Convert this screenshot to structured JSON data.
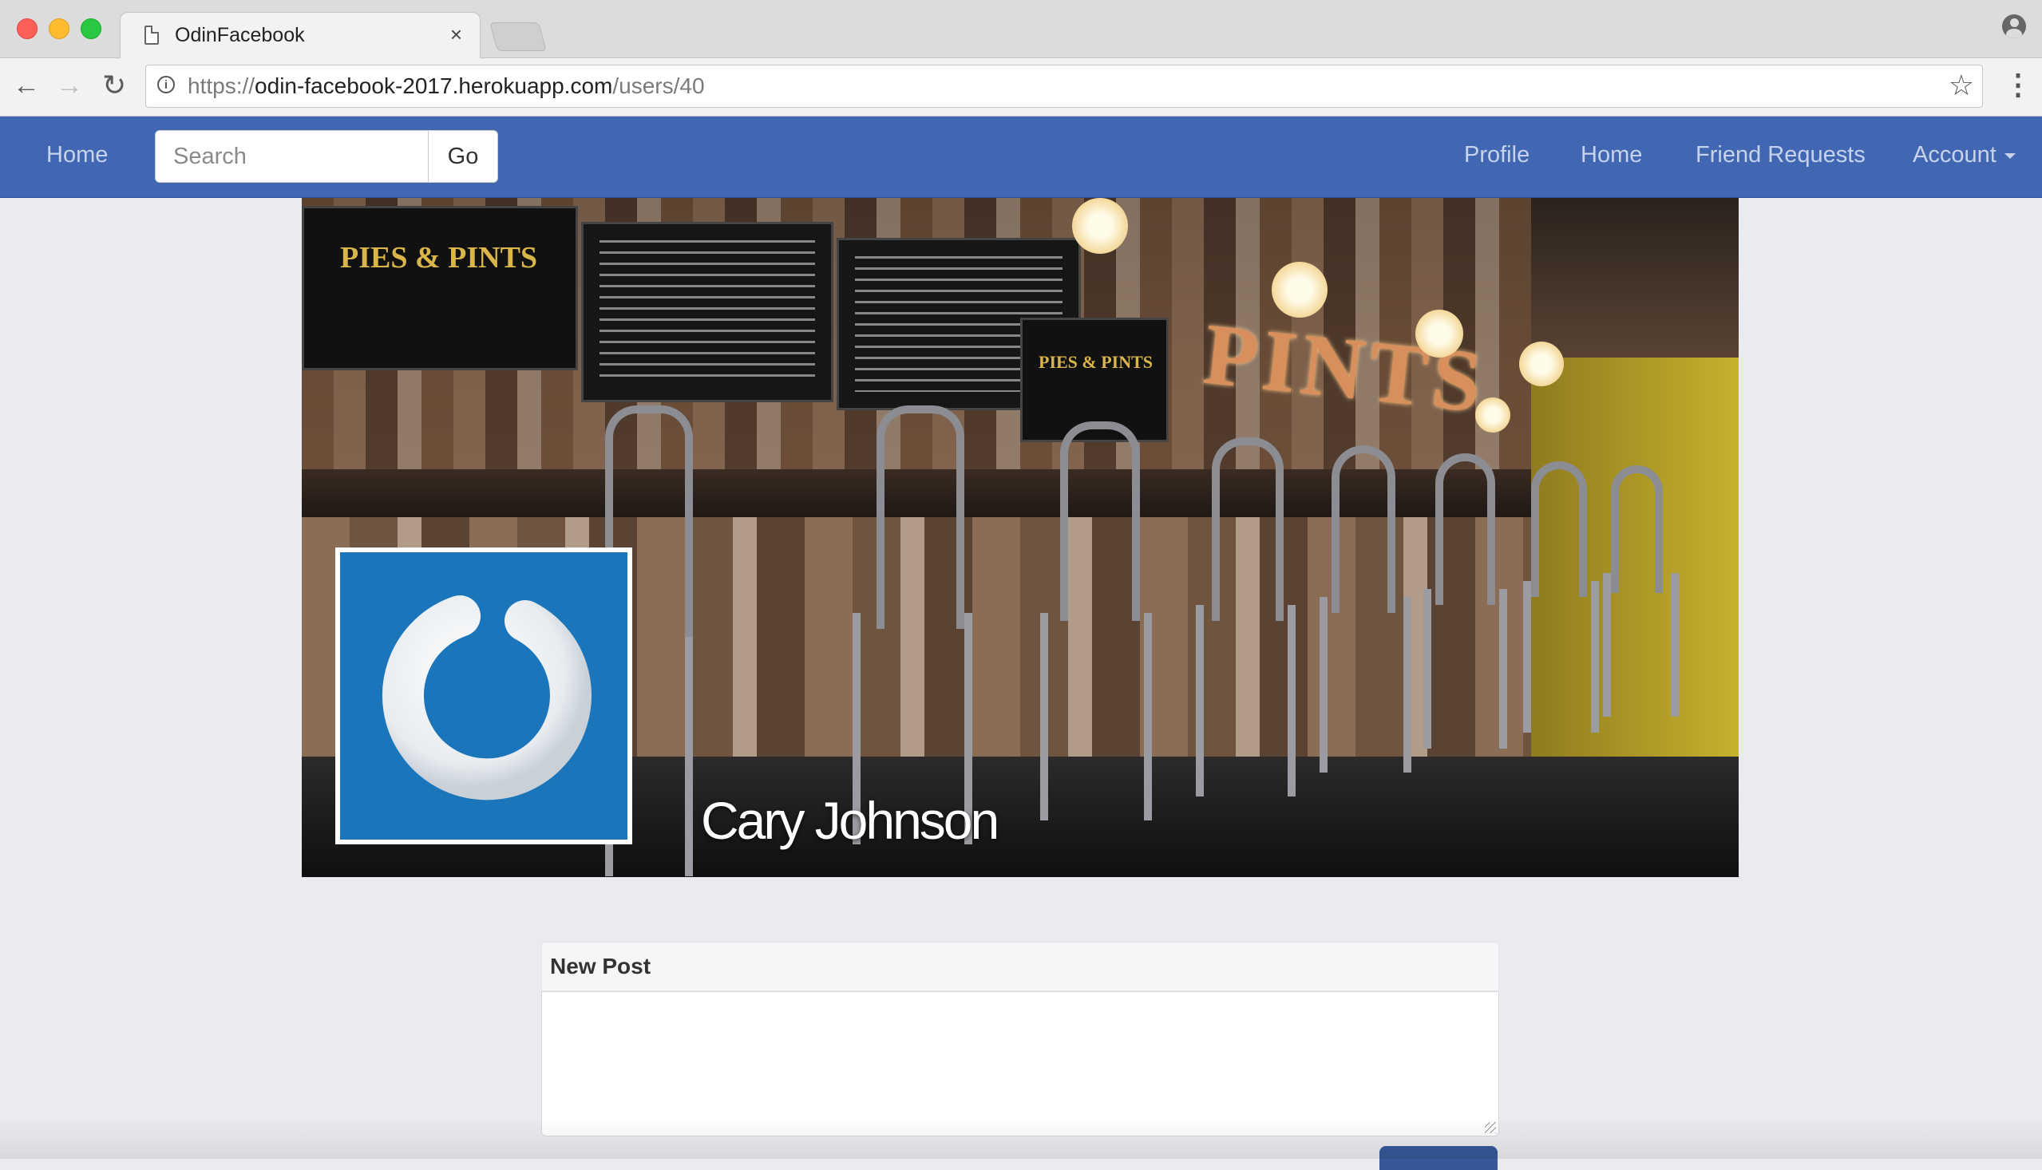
{
  "browser": {
    "tab_title": "OdinFacebook",
    "tab_close": "×",
    "url_scheme": "https://",
    "url_host": "odin-facebook-2017.herokuapp.com",
    "url_path": "/users/40",
    "back_glyph": "←",
    "forward_glyph": "→",
    "reload_glyph": "↻",
    "info_glyph": "i",
    "star_glyph": "☆",
    "menu_glyph": "⋮"
  },
  "navbar": {
    "home_left": "Home",
    "search_placeholder": "Search",
    "go_label": "Go",
    "links": {
      "profile": "Profile",
      "home": "Home",
      "friend_requests": "Friend Requests",
      "account": "Account"
    }
  },
  "cover": {
    "board_text_1": "PIES & PINTS",
    "board_text_2": "PIES & PINTS",
    "sign_text": "PINTS",
    "user_name": "Cary Johnson"
  },
  "new_post": {
    "title": "New Post",
    "body": ""
  },
  "colors": {
    "navbar": "#4267b2",
    "avatar_bg": "#1b75bb",
    "page_bg": "#e9ebee"
  },
  "icons": [
    "page-icon",
    "back-icon",
    "forward-icon",
    "reload-icon",
    "info-icon",
    "star-icon",
    "menu-icon",
    "profile-icon",
    "caret-down-icon",
    "gliffy-power-logo"
  ]
}
